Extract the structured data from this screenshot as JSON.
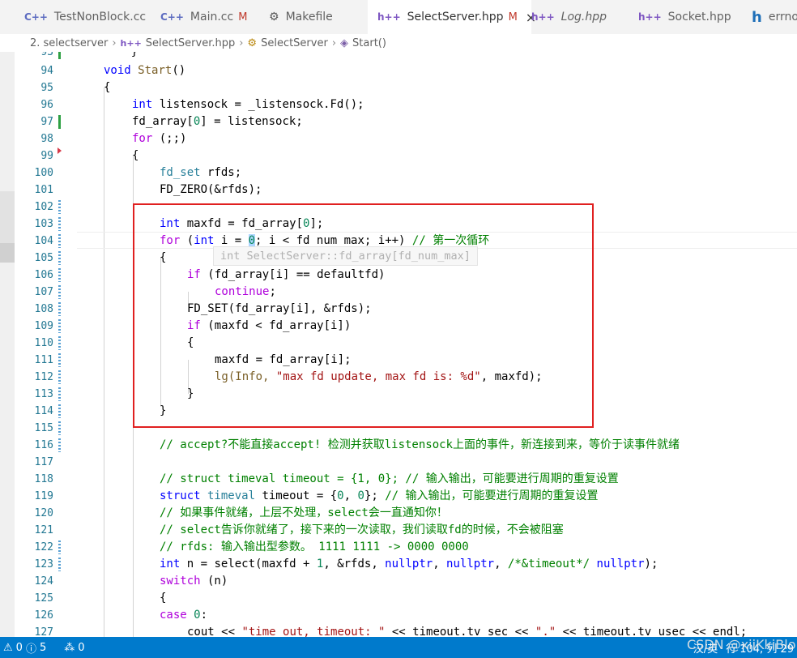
{
  "tabs": [
    {
      "icon": "C++",
      "label": "TestNonBlock.cc",
      "modified": "",
      "italic": false
    },
    {
      "icon": "C++",
      "label": "Main.cc",
      "modified": "M",
      "italic": false
    },
    {
      "icon": "⚙",
      "label": "Makefile",
      "modified": "",
      "italic": false
    },
    {
      "icon": "h++",
      "label": "SelectServer.hpp",
      "modified": "M",
      "italic": false,
      "active": true,
      "close": "×"
    },
    {
      "icon": "h++",
      "label": "Log.hpp",
      "modified": "",
      "italic": true
    },
    {
      "icon": "h++",
      "label": "Socket.hpp",
      "modified": "",
      "italic": false
    },
    {
      "icon": "h",
      "label": "errno",
      "modified": "",
      "italic": false
    }
  ],
  "breadcrumb": {
    "folder": "2. selectserver",
    "file": "SelectServer.hpp",
    "class": "SelectServer",
    "method": "Start()"
  },
  "hover_hint": "int SelectServer::fd_array[fd_num_max]",
  "lines": {
    "l93": "93",
    "l94": "94",
    "l95": "95",
    "l96": "96",
    "l97": "97",
    "l98": "98",
    "l99": "99",
    "l100": "100",
    "l101": "101",
    "l102": "102",
    "l103": "103",
    "l104": "104",
    "l105": "105",
    "l106": "106",
    "l107": "107",
    "l108": "108",
    "l109": "109",
    "l110": "110",
    "l111": "111",
    "l112": "112",
    "l113": "113",
    "l114": "114",
    "l115": "115",
    "l116": "116",
    "l117": "117",
    "l118": "118",
    "l119": "119",
    "l120": "120",
    "l121": "121",
    "l122": "122",
    "l123": "123",
    "l124": "124",
    "l125": "125",
    "l126": "126",
    "l127": "127"
  },
  "code": {
    "c93": "    }",
    "c94_kw": "void",
    "c94_fn": "Start",
    "c94_rest": "()",
    "c95": "{",
    "c96_kw": "int",
    "c96_rest": " listensock = _listensock.Fd();",
    "c97_a": "fd_array[",
    "c97_n": "0",
    "c97_b": "] = listensock;",
    "c98_kw": "for",
    "c98_rest": " (;;)",
    "c99": "{",
    "c100_ty": "fd_set",
    "c100_rest": " rfds;",
    "c101": "FD_ZERO(&rfds);",
    "c103_kw": "int",
    "c103_a": " maxfd = fd_array[",
    "c103_n": "0",
    "c103_b": "];",
    "c104_kw": "for",
    "c104_a": " (",
    "c104_kw2": "int",
    "c104_b": " i = ",
    "c104_n": "0",
    "c104_c": "; i < fd_num_max; i++) ",
    "c104_cm": "// 第一次循环",
    "c105": "{",
    "c106_kw": "if",
    "c106_rest": " (fd_array[i] == defaultfd)",
    "c107_kw": "continue",
    "c107_rest": ";",
    "c108": "FD_SET(fd_array[i], &rfds);",
    "c109_kw": "if",
    "c109_rest": " (maxfd < fd_array[i])",
    "c110": "{",
    "c111": "maxfd = fd_array[i];",
    "c112_a": "lg(Info, ",
    "c112_str": "\"max fd update, max fd is: %d\"",
    "c112_b": ", maxfd);",
    "c113": "}",
    "c114": "}",
    "c116_cm": "// accept?不能直接accept! 检测并获取listensock上面的事件，新连接到来，等价于读事件就绪",
    "c118_cm": "// struct timeval timeout = {1, 0}; // 输入输出，可能要进行周期的重复设置",
    "c119_kw": "struct",
    "c119_ty": " timeval",
    "c119_a": " timeout = {",
    "c119_n1": "0",
    "c119_b": ", ",
    "c119_n2": "0",
    "c119_c": "}; ",
    "c119_cm": "// 输入输出，可能要进行周期的重复设置",
    "c120_cm": "// 如果事件就绪，上层不处理，select会一直通知你！",
    "c121_cm": "// select告诉你就绪了，接下来的一次读取，我们读取fd的时候，不会被阻塞",
    "c122_cm": "// rfds: 输入输出型参数。 1111 1111 -> 0000 0000",
    "c123_kw": "int",
    "c123_a": " n = select(maxfd + ",
    "c123_n": "1",
    "c123_b": ", &rfds, ",
    "c123_kw2": "nullptr",
    "c123_c": ", ",
    "c123_kw3": "nullptr",
    "c123_d": ", ",
    "c123_cm": "/*&timeout*/",
    "c123_e": " ",
    "c123_kw4": "nullptr",
    "c123_f": ");",
    "c124_kw": "switch",
    "c124_rest": " (n)",
    "c125": "{",
    "c126_kw": "case",
    "c126_n": " 0",
    "c126_rest": ":",
    "c127_a": "cout << ",
    "c127_str": "\"time out, timeout: \"",
    "c127_b": " << timeout.tv_sec << ",
    "c127_str2": "\".\"",
    "c127_c": " << timeout.tv_usec << endl;"
  },
  "status": {
    "errors": "0",
    "warnings": "5",
    "ports": "0",
    "right_a": "汉/英",
    "right_b": "行 104, 列 29"
  },
  "watermark": "CSDN @xiiKkiBlo"
}
